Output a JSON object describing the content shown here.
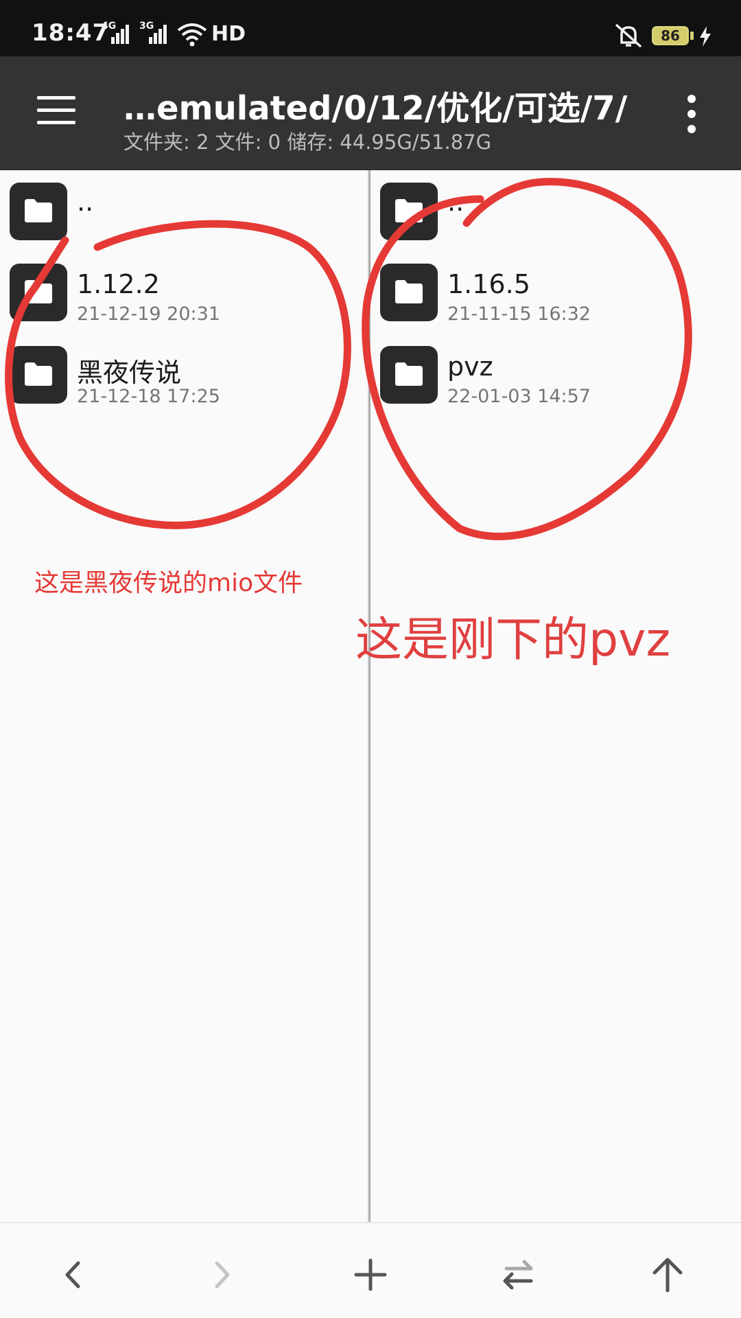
{
  "status_bar": {
    "time": "18:47",
    "signal_1": "4G",
    "signal_2": "3G",
    "hd": "HD",
    "battery": "86",
    "icons": [
      "signal-icon",
      "wifi-icon",
      "mute-icon",
      "battery-icon",
      "charging-icon"
    ]
  },
  "toolbar": {
    "path": "…emulated/0/12/优化/可选/7/",
    "summary": "文件夹: 2  文件: 0  储存: 44.95G/51.87G"
  },
  "left_pane": {
    "items": [
      {
        "name": "..",
        "date": ""
      },
      {
        "name": "1.12.2",
        "date": "21-12-19 20:31"
      },
      {
        "name": "黑夜传说",
        "date": "21-12-18 17:25"
      }
    ]
  },
  "right_pane": {
    "items": [
      {
        "name": "..",
        "date": ""
      },
      {
        "name": "1.16.5",
        "date": "21-11-15 16:32"
      },
      {
        "name": "pvz",
        "date": "22-01-03 14:57"
      }
    ]
  },
  "annotations": {
    "left_note": "这是黑夜传说的mio文件",
    "right_note": "这是刚下的pvz",
    "color": "#e53935"
  },
  "bottom_nav": {
    "icons": [
      "back-icon",
      "forward-icon",
      "add-icon",
      "swap-icon",
      "up-icon"
    ]
  },
  "colors": {
    "toolbar": "#333333",
    "status_bar": "#111111",
    "folder_tile": "#2a2a2a",
    "background": "#fafafa"
  }
}
